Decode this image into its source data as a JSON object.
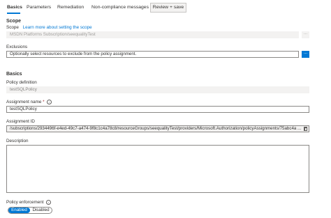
{
  "tabs": [
    {
      "label": "Basics",
      "active": true
    },
    {
      "label": "Parameters"
    },
    {
      "label": "Remediation"
    },
    {
      "label": "Non-compliance messages"
    },
    {
      "label": "Review + save"
    }
  ],
  "scope": {
    "section_title": "Scope",
    "label": "Scope",
    "link": "Learn more about setting the scope",
    "value": "MSDN Platforms Subscription/seequalityTest",
    "button": "..."
  },
  "exclusions": {
    "label": "Exclusions",
    "placeholder": "Optionally select resources to exclude from the policy assignment.",
    "button": "..."
  },
  "basics": {
    "section_title": "Basics",
    "policy_definition": {
      "label": "Policy definition",
      "value": "testSQLPolicy"
    },
    "assignment_name": {
      "label": "Assignment name",
      "required_mark": "*",
      "info": "i",
      "value": "testSQLPolicy"
    },
    "assignment_id": {
      "label": "Assignment ID",
      "value": "/subscriptions/2934496f-e4ed-49c7-a474-9f8c1c4a78c8/resourceGroups/seequalityTest/providers/Microsoft.Authorization/policyAssignments/75abc4a ..."
    },
    "description": {
      "label": "Description",
      "value": ""
    },
    "policy_enforcement": {
      "label": "Policy enforcement",
      "info": "i",
      "enabled_label": "Enabled",
      "disabled_label": "Disabled",
      "selected": "Enabled"
    }
  },
  "colors": {
    "accent": "#0078d4",
    "required": "#a4262c",
    "disabled_bg": "#f3f2f1"
  }
}
